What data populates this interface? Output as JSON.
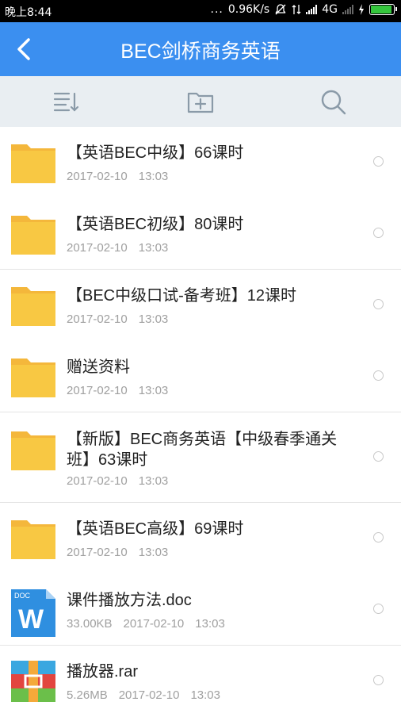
{
  "status_bar": {
    "time": "晚上8:44",
    "dots": "...",
    "speed": "0.96K/s",
    "network": "4G"
  },
  "header": {
    "title": "BEC剑桥商务英语"
  },
  "toolbar": {
    "sort_icon": "sort-icon",
    "new_folder_icon": "new-folder-icon",
    "search_icon": "search-icon"
  },
  "files": [
    {
      "name": "【英语BEC中级】66课时",
      "size": "",
      "date": "2017-02-10",
      "time": "13:03",
      "type": "folder"
    },
    {
      "name": "【英语BEC初级】80课时",
      "size": "",
      "date": "2017-02-10",
      "time": "13:03",
      "type": "folder"
    },
    {
      "name": "【BEC中级口试-备考班】12课时",
      "size": "",
      "date": "2017-02-10",
      "time": "13:03",
      "type": "folder"
    },
    {
      "name": "赠送资料",
      "size": "",
      "date": "2017-02-10",
      "time": "13:03",
      "type": "folder"
    },
    {
      "name": "【新版】BEC商务英语【中级春季通关班】63课时",
      "size": "",
      "date": "2017-02-10",
      "time": "13:03",
      "type": "folder"
    },
    {
      "name": "【英语BEC高级】69课时",
      "size": "",
      "date": "2017-02-10",
      "time": "13:03",
      "type": "folder"
    },
    {
      "name": "课件播放方法.doc",
      "size": "33.00KB",
      "date": "2017-02-10",
      "time": "13:03",
      "type": "doc",
      "doc_badge": "DOC",
      "doc_letter": "W"
    },
    {
      "name": "播放器.rar",
      "size": "5.26MB",
      "date": "2017-02-10",
      "time": "13:03",
      "type": "rar"
    }
  ],
  "colors": {
    "header": "#3b8ff0",
    "toolbar": "#e9eef2",
    "folder": "#f7c13f",
    "doc": "#2b8fe0"
  }
}
